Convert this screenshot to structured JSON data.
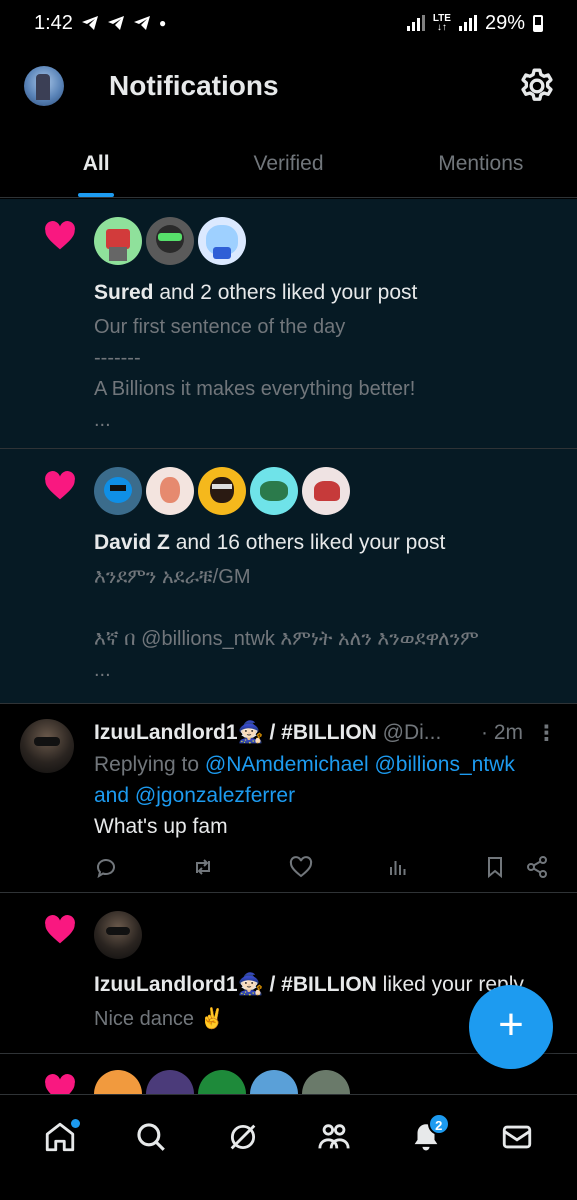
{
  "status_bar": {
    "time": "1:42",
    "lte": "LTE",
    "battery": "29%"
  },
  "header": {
    "title": "Notifications"
  },
  "tabs": [
    {
      "label": "All",
      "active": true
    },
    {
      "label": "Verified",
      "active": false
    },
    {
      "label": "Mentions",
      "active": false
    }
  ],
  "notifications": [
    {
      "actor": "Sured",
      "action": " and 2 others liked your post",
      "lines": [
        "Our first sentence of the day",
        "-------",
        "A Billions it makes everything better!",
        "..."
      ]
    },
    {
      "actor": "David Z",
      "action": " and 16 others liked your post",
      "lines": [
        "እንደምን አደራቹ/GM",
        "",
        "እኛ በ @billions_ntwk እምነት አለን እንወደዋለንም",
        "..."
      ]
    },
    {
      "actor": "IzuuLandlord1🧙🏻 / #BILLION",
      "action": " liked your reply",
      "lines": [
        "Nice dance ✌️"
      ]
    }
  ],
  "post": {
    "author": "IzuuLandlord1🧙🏻 / #BILLION",
    "handle": " @Di...",
    "time": "· 2m",
    "more": "⋮",
    "replying_prefix": "Replying to ",
    "mention1": "@NAmdemichael",
    "mention2": " @billions_ntwk",
    "and_text": "and ",
    "mention3": "@jgonzalezferrer",
    "body": "What's up fam"
  },
  "fab": {
    "label": "+"
  },
  "bottom_nav": {
    "notification_badge": "2"
  },
  "colors": {
    "accent": "#1d9bf0",
    "like": "#f91880",
    "unread_bg": "#061a24"
  }
}
